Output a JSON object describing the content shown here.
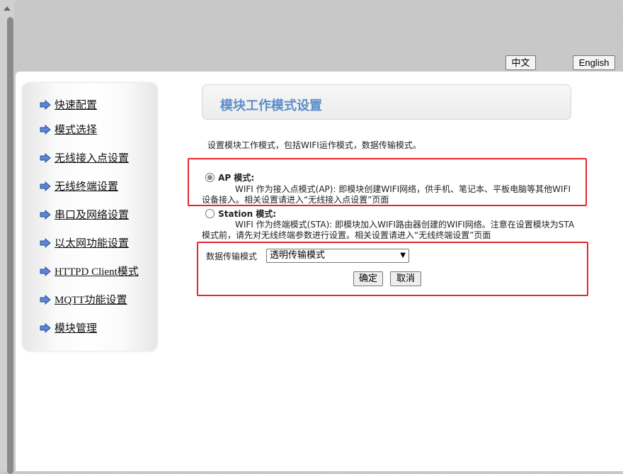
{
  "lang": {
    "zh": "中文",
    "en": "English"
  },
  "sidebar": {
    "items": [
      {
        "label": "快速配置"
      },
      {
        "label": "模式选择"
      },
      {
        "label": "无线接入点设置"
      },
      {
        "label": "无线终端设置"
      },
      {
        "label": "串口及网络设置"
      },
      {
        "label": "以太网功能设置"
      },
      {
        "label": "HTTPD Client模式"
      },
      {
        "label": "MQTT功能设置"
      },
      {
        "label": "模块管理"
      }
    ]
  },
  "main": {
    "title": "模块工作模式设置",
    "description": "设置模块工作模式，包括WIFI运作模式，数据传输模式。",
    "ap": {
      "label": "AP 模式:",
      "desc1": "WIFI 作为接入点模式(AP): 即模块创建WIFI网络，供手机、笔记本、平板电脑等其他WIFI",
      "desc2": "设备接入。相关设置请进入“无线接入点设置”页面",
      "checked": true
    },
    "sta": {
      "label": "Station 模式:",
      "desc1": "WIFI 作为终端模式(STA): 即模块加入WIFI路由器创建的WIFI网络。注意在设置模块为STA",
      "desc2": "模式前，请先对无线终端参数进行设置。相关设置请进入“无线终端设置”页面",
      "checked": false
    },
    "transfer": {
      "label": "数据传输模式",
      "selected": "透明传输模式"
    },
    "ok": "确定",
    "cancel": "取消"
  }
}
